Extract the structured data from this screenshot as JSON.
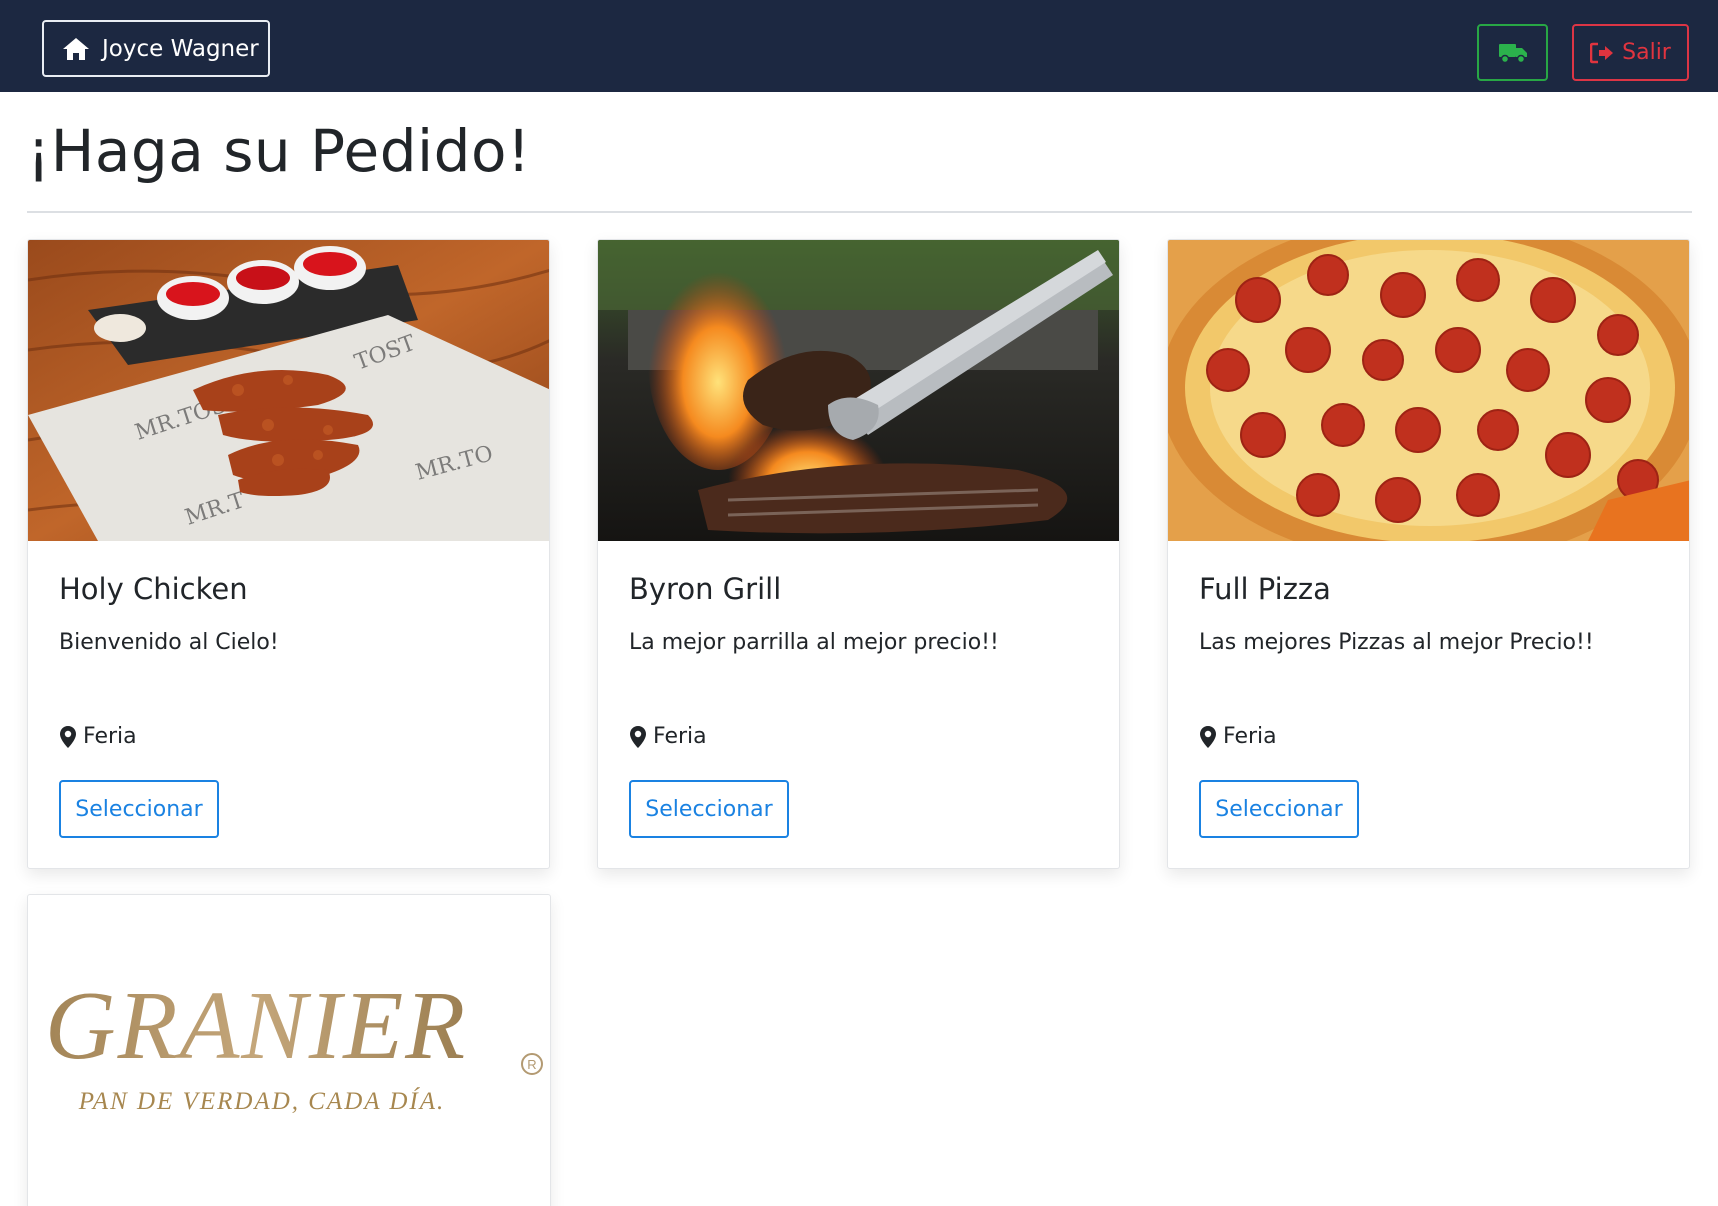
{
  "navbar": {
    "user_name": "Joyce Wagner",
    "user_icon": "home-icon",
    "delivery_icon": "truck-icon",
    "exit_label": "Salir",
    "exit_icon": "sign-out-icon",
    "colors": {
      "bar": "#1c2841",
      "delivery": "#28a745",
      "exit": "#dc3545"
    }
  },
  "main": {
    "title": "¡Haga su Pedido!"
  },
  "restaurants": [
    {
      "name": "Holy Chicken",
      "description": "Bienvenido al Cielo!",
      "location": "Feria",
      "button_label": "Seleccionar",
      "image": "fried-chicken-photo"
    },
    {
      "name": "Byron Grill",
      "description": "La mejor parrilla al mejor precio!!",
      "location": "Feria",
      "button_label": "Seleccionar",
      "image": "grill-fire-photo"
    },
    {
      "name": "Full Pizza",
      "description": "Las mejores Pizzas al mejor Precio!!",
      "location": "Feria",
      "button_label": "Seleccionar",
      "image": "pepperoni-pizza-photo"
    },
    {
      "logo_name": "GRANIER",
      "logo_tagline": "PAN DE VERDAD, CADA DÍA.",
      "image": "granier-logo"
    }
  ],
  "accent_color": "#1a82e2",
  "location_icon": "map-marker-icon"
}
